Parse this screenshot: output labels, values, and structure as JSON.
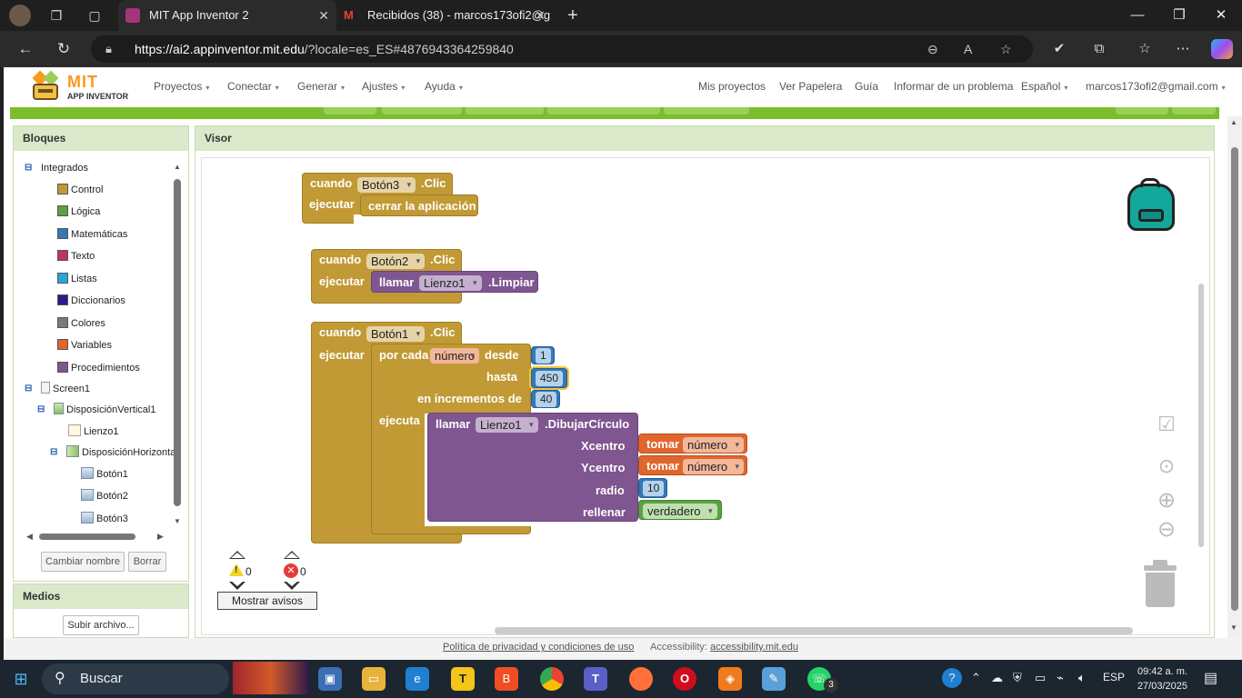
{
  "browser": {
    "tabs": [
      {
        "title": "MIT App Inventor 2",
        "active": true,
        "favicon_color": "#a3367a"
      },
      {
        "title": "Recibidos (38) - marcos173ofi2@g",
        "active": false,
        "favicon_color": "#c5221f"
      }
    ],
    "url_host": "https://ai2.appinventor.mit.edu",
    "url_rest": "/?locale=es_ES#4876943364259840"
  },
  "app": {
    "logo_main": "MIT",
    "logo_sub": "APP INVENTOR",
    "menus_left": [
      "Proyectos",
      "Conectar",
      "Generar",
      "Ajustes",
      "Ayuda"
    ],
    "menus_right": [
      "Mis proyectos",
      "Ver Papelera",
      "Guía",
      "Informar de un problema",
      "Español",
      "marcos173ofi2@gmail.com"
    ]
  },
  "blocks_panel": {
    "title": "Bloques",
    "builtin_label": "Integrados",
    "categories": [
      {
        "label": "Control",
        "color": "#c19a35"
      },
      {
        "label": "Lógica",
        "color": "#5ba045"
      },
      {
        "label": "Matemáticas",
        "color": "#3279b8"
      },
      {
        "label": "Texto",
        "color": "#c2335f"
      },
      {
        "label": "Listas",
        "color": "#2ea3d9"
      },
      {
        "label": "Diccionarios",
        "color": "#2d1b8c"
      },
      {
        "label": "Colores",
        "color": "#7a7a7a"
      },
      {
        "label": "Variables",
        "color": "#e1662c"
      },
      {
        "label": "Procedimientos",
        "color": "#7f5690"
      }
    ],
    "components": {
      "screen": "Screen1",
      "vertical": "DisposiciónVertical1",
      "canvas": "Lienzo1",
      "horizontal": "DisposiciónHorizontal1",
      "buttons": [
        "Botón1",
        "Botón2",
        "Botón3"
      ]
    },
    "rename_button": "Cambiar nombre",
    "delete_button": "Borrar"
  },
  "media_panel": {
    "title": "Medios",
    "upload_button": "Subir archivo..."
  },
  "visor": {
    "title": "Visor",
    "block3": {
      "when": "cuando",
      "component": "Botón3",
      "event": ".Clic",
      "do": "ejecutar",
      "action": "cerrar la aplicación"
    },
    "block2": {
      "when": "cuando",
      "component": "Botón2",
      "event": ".Clic",
      "do": "ejecutar",
      "call": "llamar",
      "target": "Lienzo1",
      "method": ".Limpiar"
    },
    "block1": {
      "when": "cuando",
      "component": "Botón1",
      "event": ".Clic",
      "do": "ejecutar",
      "for_each": "por cada",
      "var_name": "número",
      "from": "desde",
      "from_val": "1",
      "to": "hasta",
      "to_val": "450",
      "step": "en incrementos de",
      "step_val": "40",
      "do_loop": "ejecuta",
      "call": "llamar",
      "target": "Lienzo1",
      "method": ".DibujarCírculo",
      "xc": "Xcentro",
      "yc": "Ycentro",
      "radius": "radio",
      "radius_val": "10",
      "fill": "rellenar",
      "get": "tomar",
      "fill_val": "verdadero"
    },
    "warnings_count": "0",
    "errors_count": "0",
    "show_warnings": "Mostrar avisos"
  },
  "footer": {
    "privacy": "Política de privacidad y condiciones de uso",
    "accessibility_label": "Accessibility:",
    "accessibility_link": "accessibility.mit.edu"
  },
  "taskbar": {
    "search": "Buscar",
    "lang": "ESP",
    "time": "09:42 a. m.",
    "date": "27/03/2025",
    "whatsapp_badge": "3"
  }
}
